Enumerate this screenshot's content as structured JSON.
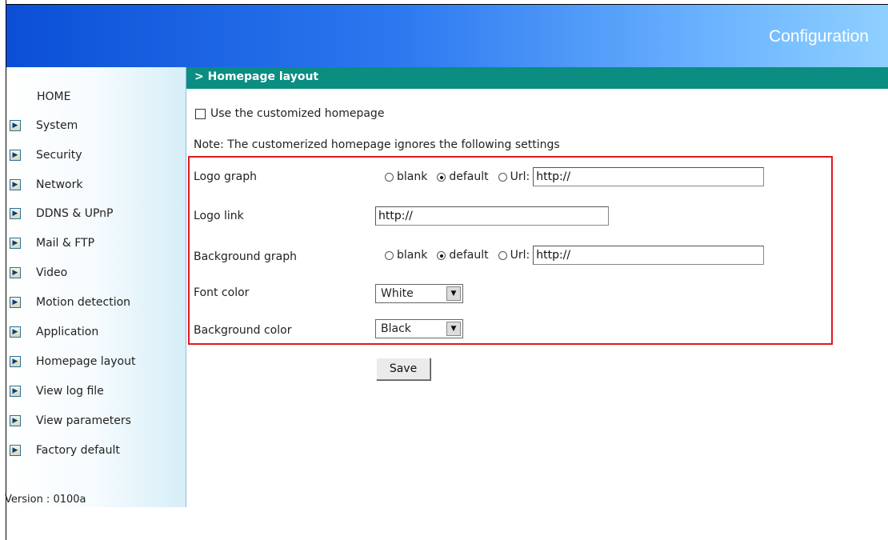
{
  "header": {
    "title": "Configuration"
  },
  "sidebar": {
    "home_label": "HOME",
    "items": [
      {
        "label": "System"
      },
      {
        "label": "Security"
      },
      {
        "label": "Network"
      },
      {
        "label": "DDNS & UPnP"
      },
      {
        "label": "Mail & FTP"
      },
      {
        "label": "Video"
      },
      {
        "label": "Motion detection"
      },
      {
        "label": "Application"
      },
      {
        "label": "Homepage layout"
      },
      {
        "label": "View log file"
      },
      {
        "label": "View parameters"
      },
      {
        "label": "Factory default"
      }
    ],
    "version": "Version : 0100a"
  },
  "section": {
    "title": "> Homepage layout"
  },
  "form": {
    "custom_homepage": {
      "label": "Use the customized homepage",
      "checked": false
    },
    "note": "Note: The customerized homepage ignores the following settings",
    "logo_graph": {
      "label": "Logo graph",
      "opt_blank": "blank",
      "opt_default": "default",
      "opt_url": "Url:",
      "selected": "default",
      "url_value": "http://"
    },
    "logo_link": {
      "label": "Logo link",
      "value": "http://"
    },
    "background_graph": {
      "label": "Background graph",
      "opt_blank": "blank",
      "opt_default": "default",
      "opt_url": "Url:",
      "selected": "default",
      "url_value": "http://"
    },
    "font_color": {
      "label": "Font color",
      "value": "White"
    },
    "background_color": {
      "label": "Background color",
      "value": "Black"
    },
    "save_label": "Save"
  },
  "colors": {
    "header_blue": "#0a4fd6",
    "section_teal": "#0b8d82",
    "highlight_red": "#e0191e"
  }
}
